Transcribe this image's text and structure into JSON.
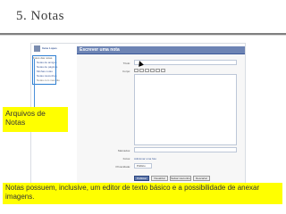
{
  "slide": {
    "title": "5. Notas"
  },
  "facebook": {
    "profile_name": "Irene Lopes",
    "panel_title": "Escrever uma nota",
    "side_items": [
      "Fotos das notas",
      "Notas de amigos",
      "Notas de páginas",
      "Minhas notas",
      "Notas rascunhos",
      "Notas com menção"
    ],
    "labels": {
      "title": "Título:",
      "body": "Corpo:",
      "tags": "Marcados:",
      "photos": "Fotos:",
      "privacy": "Privacidade:"
    },
    "photo_link": "Adicionar uma foto",
    "privacy_value": "Público",
    "buttons": [
      "Publicar",
      "Visualizar",
      "Salvar rascunho",
      "Descartar"
    ]
  },
  "callouts": {
    "side_note": "Arquivos de Notas",
    "bottom_note": "Notas possuem, inclusive, um editor de texto básico e a possibilidade de anexar imagens."
  },
  "colors": {
    "highlight": "#ffff00",
    "facebook_blue": "#3b5998",
    "selection_border": "#2f7fd1"
  }
}
